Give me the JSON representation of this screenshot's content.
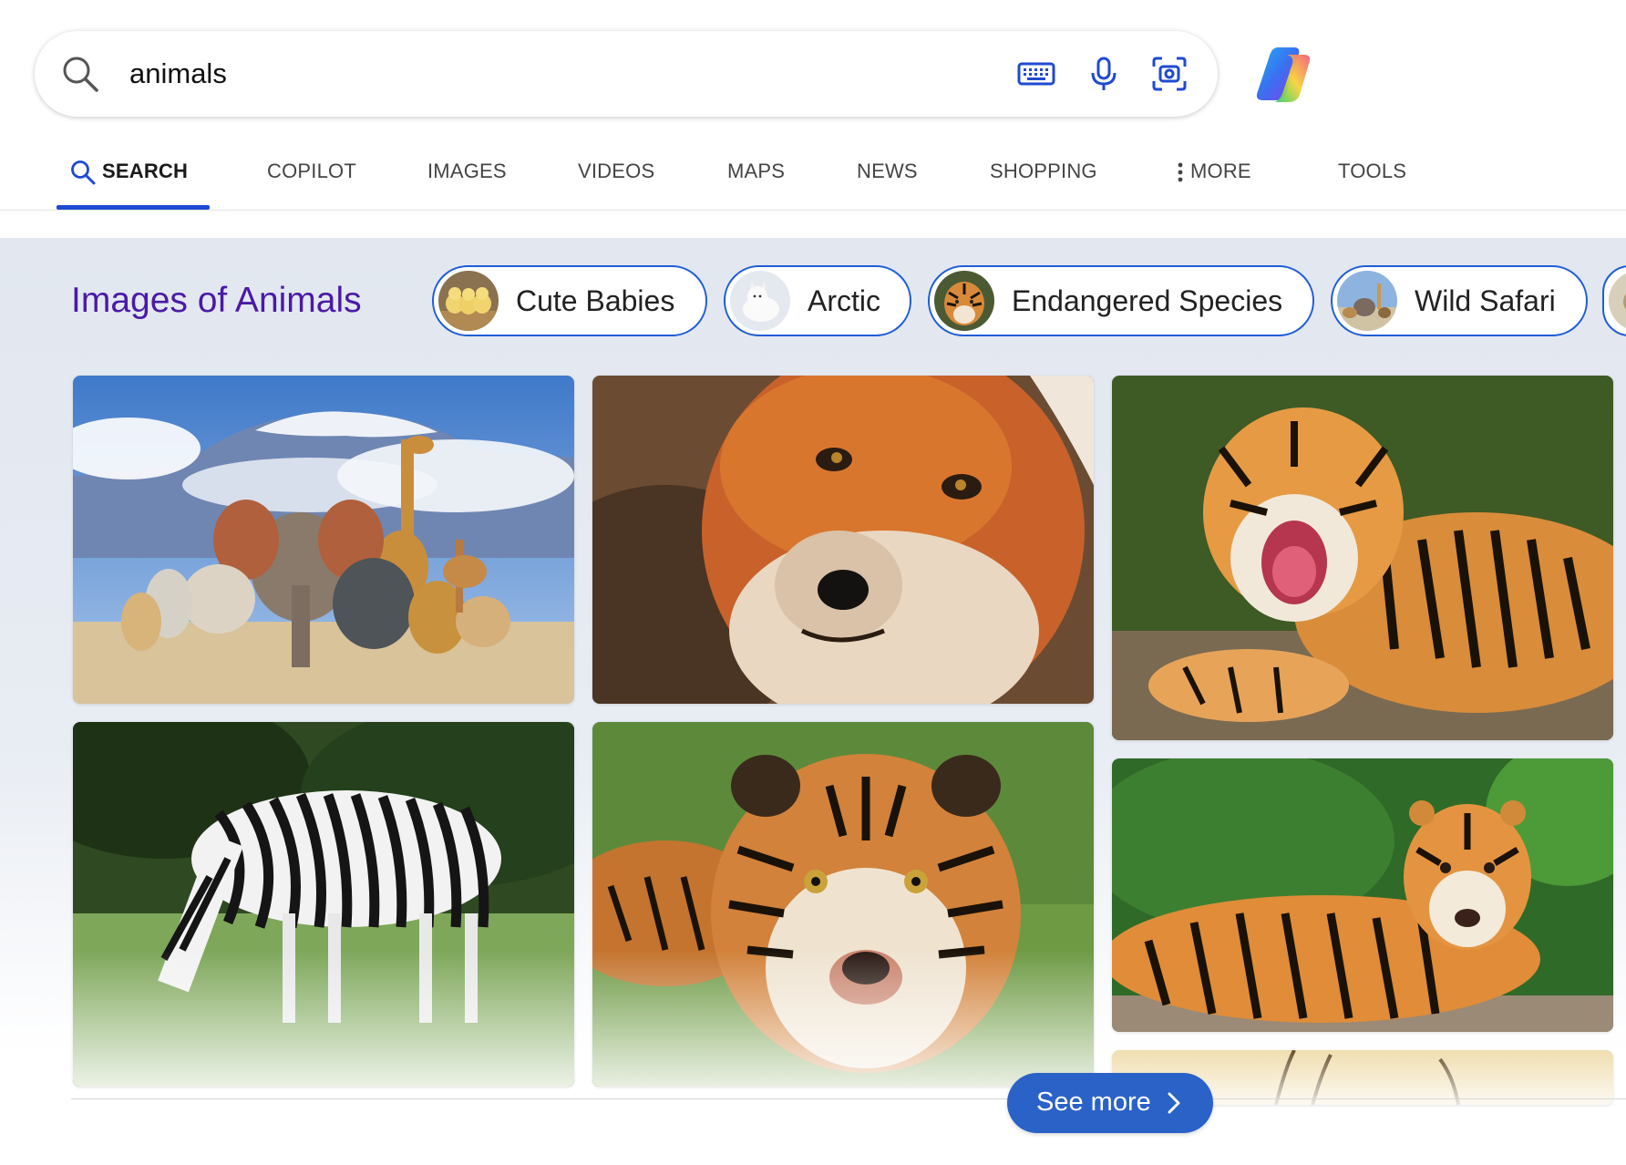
{
  "search": {
    "query": "animals"
  },
  "tabs": [
    {
      "label": "SEARCH",
      "active": true
    },
    {
      "label": "COPILOT"
    },
    {
      "label": "IMAGES"
    },
    {
      "label": "VIDEOS"
    },
    {
      "label": "MAPS"
    },
    {
      "label": "NEWS"
    },
    {
      "label": "SHOPPING"
    },
    {
      "label": "MORE"
    },
    {
      "label": "TOOLS"
    }
  ],
  "images_module": {
    "title": "Images of Animals",
    "pills": [
      {
        "label": "Cute Babies"
      },
      {
        "label": "Arctic"
      },
      {
        "label": "Endangered Species"
      },
      {
        "label": "Wild Safari"
      }
    ],
    "see_more_label": "See more"
  },
  "colors": {
    "accent": "#1f4ad0",
    "title": "#4a1aa6",
    "see_more": "#2b62c8"
  }
}
